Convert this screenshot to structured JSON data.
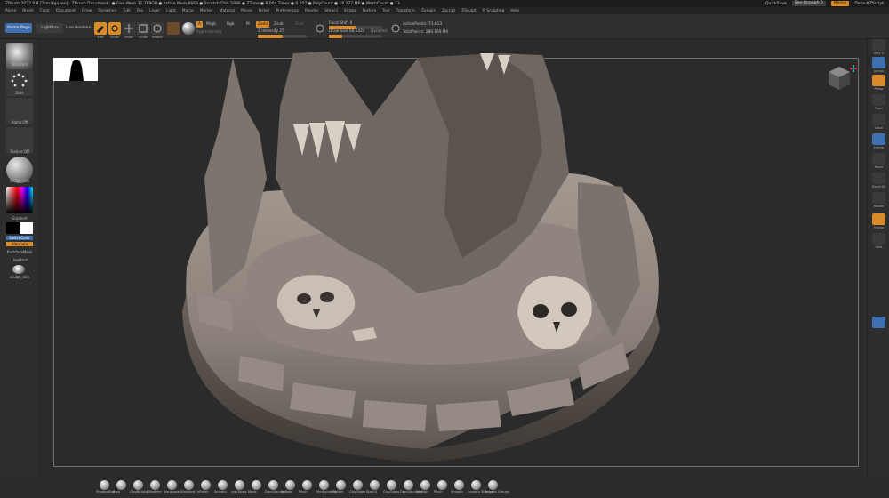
{
  "title_bar": {
    "title": "ZBrush 2022.0.8 [Tom Nguyen] · ZBrush Document · ● Free Mem 31.769GB ● Active Mem 6663 ● Scratch Disk 5986 ● ZTime ● 8.004 Timer ● 0.207 ● PolyCount ● 18.227 MP ● MeshCount ● 13",
    "quicksave": "QuickSave",
    "seethrough": "See-through 0",
    "menus_label": "Menus",
    "default_zscript": "DefaultZScript"
  },
  "menu_bar": {
    "items": [
      "Alpha",
      "Brush",
      "Color",
      "Document",
      "Draw",
      "Dynamics",
      "Edit",
      "File",
      "Layer",
      "Light",
      "Macro",
      "Marker",
      "Material",
      "Movie",
      "Picker",
      "Preferences",
      "Render",
      "Stencil",
      "Stroke",
      "Texture",
      "Tool",
      "Transform",
      "Zplugin",
      "Zscript",
      "ZSculpt",
      "P_Sculpting",
      "Help"
    ]
  },
  "toolbar": {
    "home_page": "Home Page",
    "lightbox": "LightBox",
    "live_boolean": "Live Boolean",
    "edit": "Edit",
    "draw": "Draw",
    "move": "Move",
    "scale": "Scale",
    "rotate": "Rotate",
    "a_label": "A",
    "mrgb": "Mrgb",
    "rgb": "Rgb",
    "m": "M",
    "zadd": "Zadd",
    "zsub": "Zsub",
    "zcut": "Zcut",
    "rgb_intensity": "Rgb Intensity",
    "z_intensity": "Z Intensity 25",
    "focal_shift": "Focal Shift 0",
    "draw_size": "Draw Size 58.5424",
    "dynamic": "Dynamic",
    "active_points": "ActivePoints: 73,613",
    "total_points": "TotalPoints: 280.169 Mil"
  },
  "left_shelf": {
    "brush_label": "Standard",
    "stroke_label": "Dots",
    "alpha_label": "Alpha Off",
    "texture_label": "Texture Off",
    "material_label": "sculpt_skin",
    "gradient_label": "Gradient",
    "switch_color": "SwitchColor",
    "alternate": "Alternate",
    "backface_mask": "BackfaceMask",
    "freemask": "FreeMask",
    "material2_label": "sculpt_skin"
  },
  "right_shelf": {
    "items": [
      "SPix 3",
      "Actual",
      "Persp",
      "Floor",
      "Local",
      "Frame",
      "Move",
      "Zoom3D",
      "Rotate",
      "Transp",
      "Solo"
    ]
  },
  "bottom_shelf": {
    "brushes": [
      "ShadowBox",
      "Blob",
      "ClayBuildup",
      "ZModeler",
      "Transpose",
      "Standard",
      "hPolish",
      "Smooth",
      "clayTubes",
      "Move",
      "DamStandard",
      "Inflate",
      "Pinch",
      "TrimDynamic",
      "Flatten",
      "ClayTubes",
      "Slash3",
      "ClayTubes",
      "DamStandard",
      "hPolish",
      "Pinch",
      "Smooth",
      "Smooth Stronger",
      "Smooth Groups"
    ]
  },
  "colors": {
    "accent": "#d98a2b",
    "blue": "#3e6fae",
    "background": "#2b2b2b",
    "clay": "#8f857e"
  }
}
